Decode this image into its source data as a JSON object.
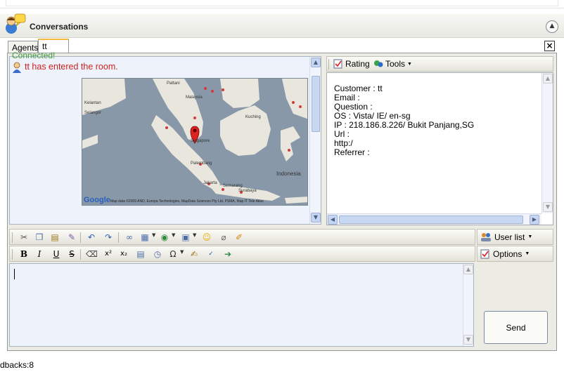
{
  "panel": {
    "title": "Conversations"
  },
  "tabs": [
    {
      "label": "Agents"
    },
    {
      "label": "tt"
    }
  ],
  "chat": {
    "status_line": "Connected!",
    "message": "tt has entered the room.",
    "map": {
      "labels": [
        "Malaysia",
        "Singapore",
        "Palembang",
        "Jakarta",
        "Semarang",
        "Surabaya",
        "Indonesia",
        "Pattani",
        "Kelantan",
        "Selangor",
        "Kuching"
      ],
      "logo": "Google",
      "copyright": "Map data ©2009 AND, Europa Technologies, MapData Sciences Pty Ltd, PSMA, Map IT Tele Atlas"
    }
  },
  "info_toolbar": {
    "rating_label": "Rating",
    "tools_label": "Tools"
  },
  "visitor": {
    "customer": "Customer : tt",
    "email": "Email :",
    "question": "Question :",
    "os": "OS : Vista/ IE/ en-sg",
    "ip": "IP : 218.186.8.226/ Bukit Panjang,SG",
    "url": "Url :",
    "url_value": "http:/",
    "referrer": "Referrer :"
  },
  "side_buttons": {
    "user_list": "User list",
    "options": "Options"
  },
  "send_label": "Send",
  "footer": "dbacks:8",
  "colors": {
    "accent_tab": "#f8b83e",
    "chat_bg": "#eef3fb",
    "message_red": "#cc1f1f",
    "status_green": "#3a9b3a"
  }
}
